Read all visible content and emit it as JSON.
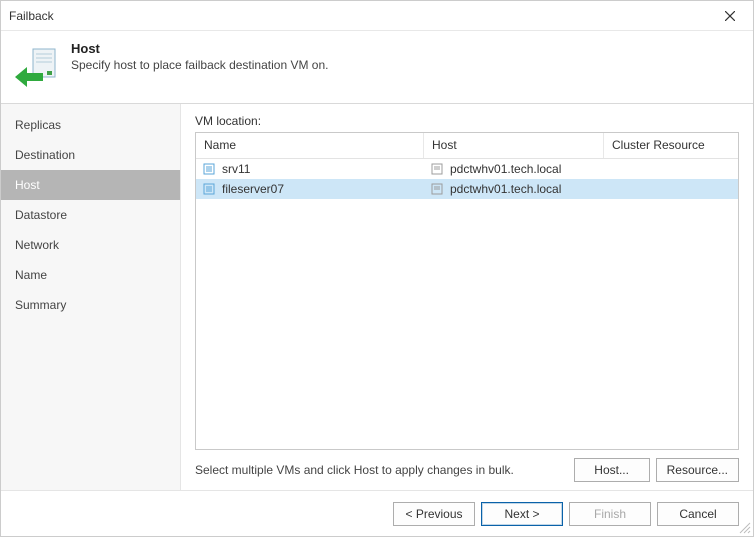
{
  "window": {
    "title": "Failback"
  },
  "header": {
    "title": "Host",
    "subtitle": "Specify host to place failback destination VM on."
  },
  "sidebar": {
    "items": [
      {
        "label": "Replicas"
      },
      {
        "label": "Destination"
      },
      {
        "label": "Host"
      },
      {
        "label": "Datastore"
      },
      {
        "label": "Network"
      },
      {
        "label": "Name"
      },
      {
        "label": "Summary"
      }
    ],
    "activeIndex": 2
  },
  "section": {
    "label": "VM location:"
  },
  "grid": {
    "columns": {
      "name": "Name",
      "host": "Host",
      "cluster": "Cluster Resource"
    },
    "rows": [
      {
        "name": "srv11",
        "host": "pdctwhv01.tech.local",
        "cluster": "",
        "selected": false
      },
      {
        "name": "fileserver07",
        "host": "pdctwhv01.tech.local",
        "cluster": "",
        "selected": true
      }
    ]
  },
  "hint": "Select multiple VMs and click Host to apply changes in bulk.",
  "buttons": {
    "host": "Host...",
    "resource": "Resource...",
    "previous": "< Previous",
    "next": "Next >",
    "finish": "Finish",
    "cancel": "Cancel"
  }
}
